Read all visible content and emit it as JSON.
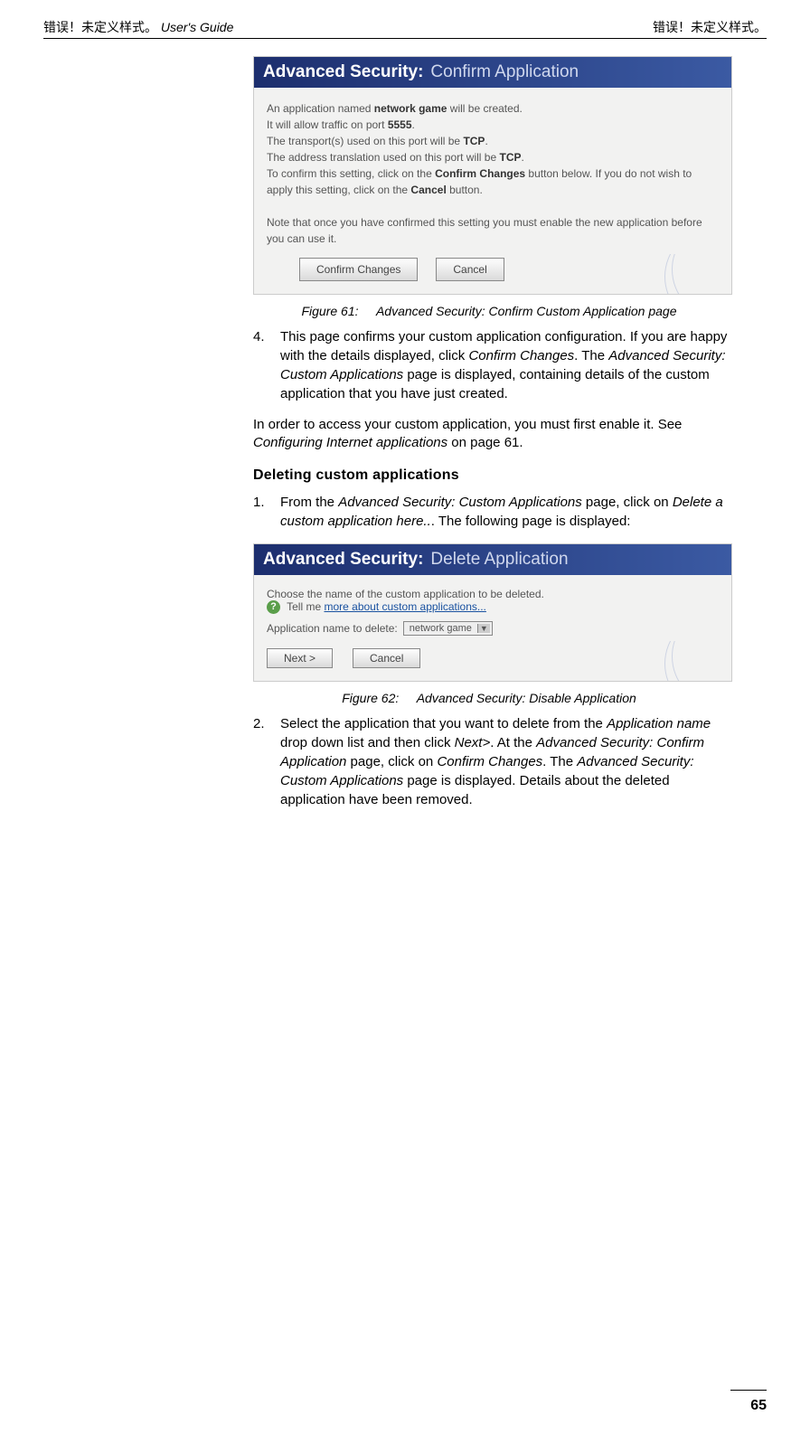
{
  "header": {
    "left_prefix": "错误！未定义样式。 ",
    "left_guide": "User's Guide",
    "right": "错误！未定义样式。"
  },
  "fig1": {
    "banner_bold": "Advanced Security:",
    "banner_light": "Confirm Application",
    "line1a": "An application named ",
    "line1b": "network game",
    "line1c": " will be created.",
    "line2a": "It will allow traffic on port ",
    "line2b": "5555",
    "line2c": ".",
    "line3a": "The transport(s) used on this port will be ",
    "line3b": "TCP",
    "line3c": ".",
    "line4a": "The address translation used on this port will be ",
    "line4b": "TCP",
    "line4c": ".",
    "line5a": "To confirm this setting, click on the ",
    "line5b": "Confirm Changes",
    "line5c": " button below. If you do not wish to apply this setting, click on the ",
    "line5d": "Cancel",
    "line5e": " button.",
    "line6": "Note that once you have confirmed this setting you must enable the new application before you can use it.",
    "btn_confirm": "Confirm Changes",
    "btn_cancel": "Cancel"
  },
  "caption1_pre": "Figure 61:",
  "caption1_txt": "Advanced Security: Confirm Custom Application page",
  "step4": {
    "num": "4.",
    "a": "This page confirms your custom application configuration. If you are happy with the details displayed, click ",
    "b": "Confirm Changes",
    "c": ". The ",
    "d": "Advanced Security: Custom Applications",
    "e": " page is displayed, containing details of the custom application that you have just created."
  },
  "para_a": "In order to access your custom application, you must first enable it. See ",
  "para_b": "Configuring Internet applications",
  "para_c": " on page 61.",
  "subhead": "Deleting custom applications",
  "step1": {
    "num": "1.",
    "a": "From the ",
    "b": "Advanced Security: Custom Applications",
    "c": " page, click on ",
    "d": "Delete a custom application here..",
    "e": ". The following page is displayed:"
  },
  "fig2": {
    "banner_bold": "Advanced Security:",
    "banner_light": "Delete Application",
    "line1": "Choose the name of the custom application to be deleted.",
    "q": "?",
    "tell": "Tell me ",
    "link": "more about custom applications...",
    "dd_label": "Application name to delete:",
    "dd_value": "network game",
    "btn_next": "Next >",
    "btn_cancel": "Cancel"
  },
  "caption2_pre": "Figure 62:",
  "caption2_txt": "Advanced Security: Disable Application",
  "step2": {
    "num": "2.",
    "a": "Select the application that you want to delete from the ",
    "b": "Application name",
    "c": " drop down list and then click ",
    "d": "Next>",
    "e": ". At the ",
    "f": "Advanced Security: Confirm Application",
    "g": " page, click on ",
    "h": "Confirm Changes",
    "i": ". The ",
    "j": "Advanced Security: Custom Applications",
    "k": " page is displayed. Details about the deleted application have been removed."
  },
  "pagenum": "65"
}
